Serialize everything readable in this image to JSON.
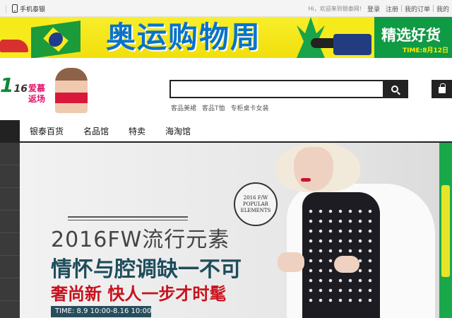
{
  "topbar": {
    "mobile_label": "手机泰银",
    "greeting": "Hi，欢迎来到银泰网!",
    "login": "登录",
    "register": "注册",
    "orders": "我的订单",
    "my_account": "我的"
  },
  "promo": {
    "title": "奥运购物周",
    "slogan": "精选好货",
    "time": "TIME:8月12日"
  },
  "header": {
    "logo_main": "1",
    "logo_sub": "16",
    "ad_text": "爱慕\n返场",
    "search_placeholder": "",
    "hot_words": [
      "客品美裙",
      "客品T恤",
      "专柜桌卡女装"
    ]
  },
  "nav": {
    "items": [
      "银泰百货",
      "名品馆",
      "特卖",
      "海淘馆"
    ]
  },
  "hero": {
    "badge_line1": "2016 F/W",
    "badge_line2": "POPULAR",
    "badge_line3": "ELEMENTS",
    "headline": "2016FW流行元素",
    "subhead": "情怀与腔调缺一不可",
    "cta": "奢尚新 快人一步才时髦",
    "time": "TIME: 8.9 10:00-8.16 10:00"
  },
  "colors": {
    "promo_yellow": "#f6ea1b",
    "promo_blue": "#0a73c9",
    "promo_green": "#0f9a44",
    "nav_dark": "#222222",
    "cta_red": "#c8121d",
    "teal": "#1f4d5c"
  }
}
